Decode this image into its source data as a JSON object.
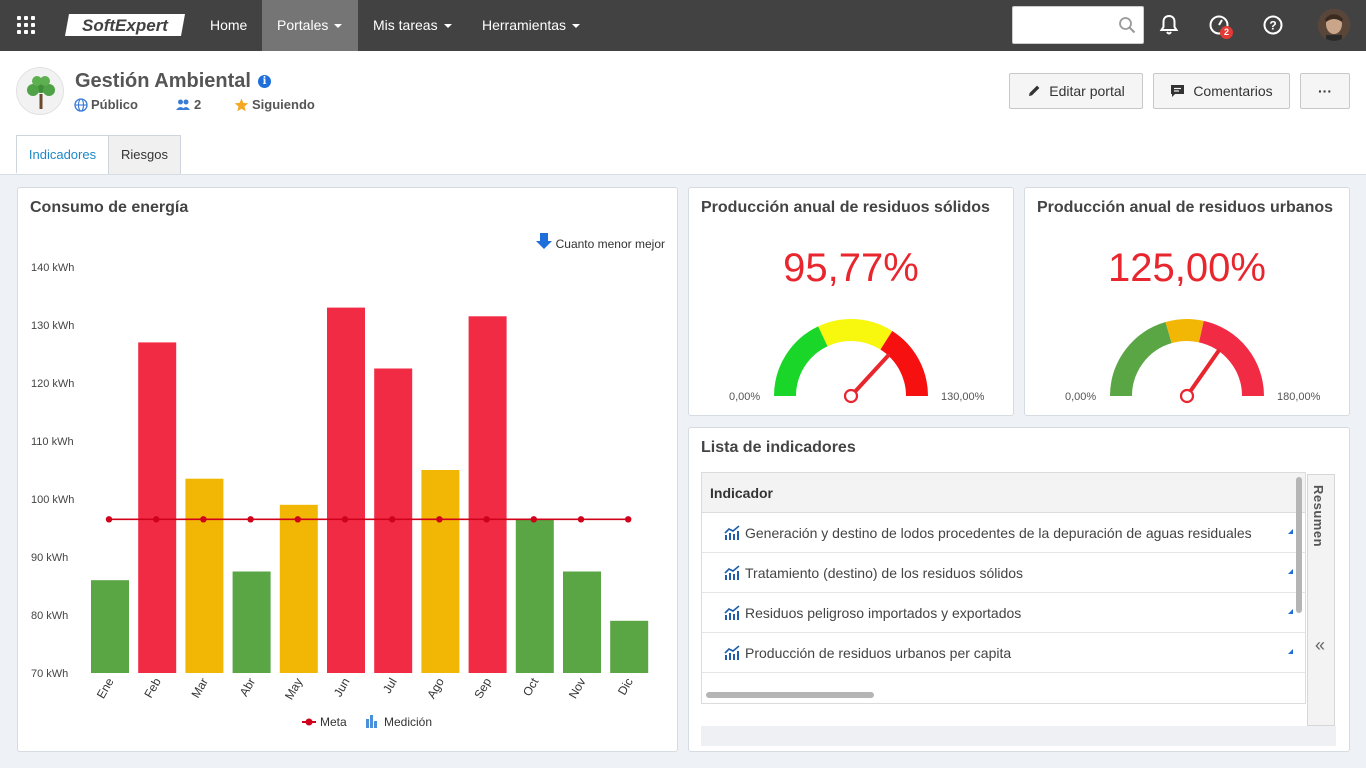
{
  "topbar": {
    "logo": "SoftExpert",
    "nav": [
      "Home",
      "Portales",
      "Mis tareas",
      "Herramientas"
    ],
    "search_placeholder": "",
    "notification_badge": "2"
  },
  "header": {
    "title": "Gestión Ambiental",
    "visibility": "Público",
    "members": "2",
    "following": "Siguiendo",
    "edit_button": "Editar portal",
    "comments_button": "Comentarios",
    "more_button": "···"
  },
  "tabs": [
    "Indicadores",
    "Riesgos"
  ],
  "energy_panel": {
    "title": "Consumo de energía",
    "hint": "Cuanto menor mejor"
  },
  "chart_data": {
    "type": "bar",
    "title": "Consumo de energía",
    "annotation": "Cuanto menor mejor",
    "categories": [
      "Ene",
      "Feb",
      "Mar",
      "Abr",
      "May",
      "Jun",
      "Jul",
      "Ago",
      "Sep",
      "Oct",
      "Nov",
      "Dic"
    ],
    "series": [
      {
        "name": "Medición",
        "type": "bar",
        "values": [
          86,
          127,
          103.5,
          87.5,
          99,
          133,
          122.5,
          105,
          131.5,
          96.5,
          87.5,
          79
        ],
        "status": [
          "green",
          "red",
          "yellow",
          "green",
          "yellow",
          "red",
          "red",
          "yellow",
          "red",
          "green",
          "green",
          "green"
        ]
      },
      {
        "name": "Meta",
        "type": "line",
        "values": [
          96.5,
          96.5,
          96.5,
          96.5,
          96.5,
          96.5,
          96.5,
          96.5,
          96.5,
          96.5,
          96.5,
          96.5
        ]
      }
    ],
    "ylim": [
      70,
      140
    ],
    "yticks": [
      "70 kWh",
      "80 kWh",
      "90 kWh",
      "100 kWh",
      "110 kWh",
      "120 kWh",
      "130 kWh",
      "140 kWh"
    ],
    "colors": {
      "green": "#5aa544",
      "yellow": "#f2b705",
      "red": "#f22b45",
      "meta": "#d0021b",
      "legend_bar": "#4a90d9"
    },
    "legend": "bottom"
  },
  "gauges": [
    {
      "title": "Producción anual de residuos sólidos",
      "value": "95,77%",
      "min": "0,00%",
      "max": "130,00%",
      "fraction": 0.7367
    },
    {
      "title": "Producción anual de residuos urbanos",
      "value": "125,00%",
      "min": "0,00%",
      "max": "180,00%",
      "fraction": 0.6944
    }
  ],
  "indicator_list": {
    "title": "Lista de indicadores",
    "column": "Indicador",
    "rows": [
      "Generación y destino de lodos procedentes de la depuración de aguas residuales",
      "Tratamiento (destino) de los residuos sólidos",
      "Residuos peligroso importados y exportados",
      "Producción de residuos urbanos per capita"
    ],
    "side_tab": "Resumen",
    "collapse_icon": "«"
  }
}
